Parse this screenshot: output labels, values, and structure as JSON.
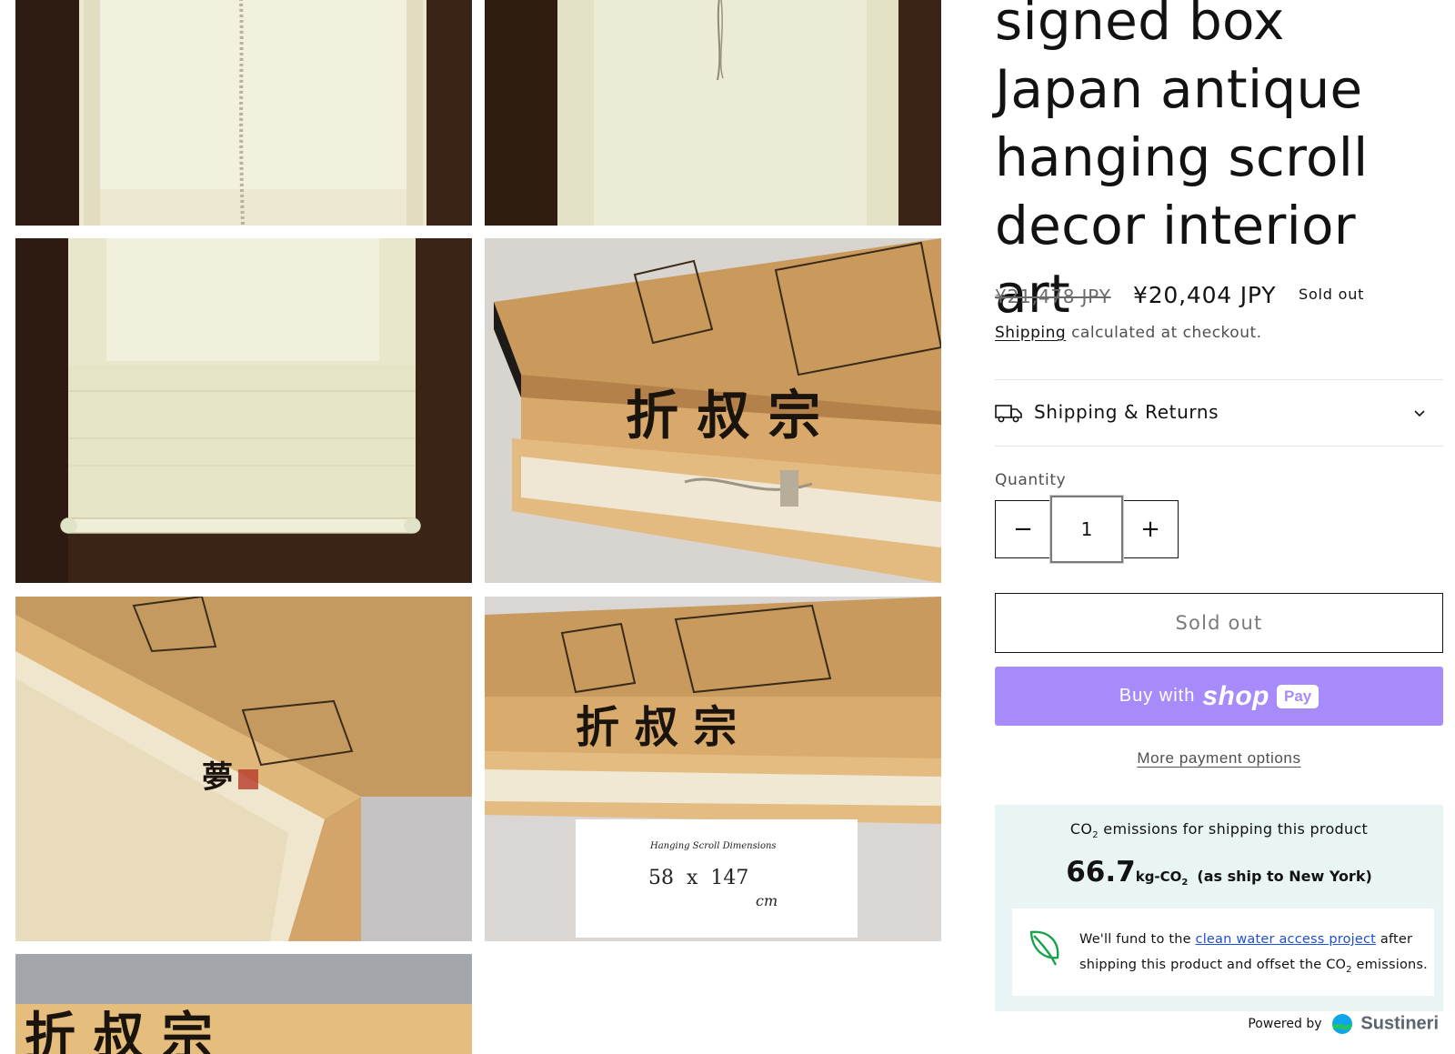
{
  "product": {
    "title": "signed box Japan antique hanging scroll decor interior art",
    "price_compare": "¥21,478 JPY",
    "price_sale": "¥20,404 JPY",
    "badge": "Sold out",
    "shipping_link": "Shipping",
    "shipping_note": "calculated at checkout."
  },
  "accordion": {
    "label": "Shipping & Returns",
    "icon": "truck-icon"
  },
  "quantity": {
    "label": "Quantity",
    "value": "1",
    "minus": "−",
    "plus": "+"
  },
  "buttons": {
    "sold_out": "Sold out",
    "buy_with": "Buy with",
    "shop_word": "shop",
    "pay_pill": "Pay",
    "more_payment": "More payment options"
  },
  "co2": {
    "title_pre": "CO",
    "title_sub": "2",
    "title_post": " emissions for shipping this product",
    "number": "66.7",
    "unit_pre": "kg-CO",
    "unit_sub": "2",
    "destination": "(as ship to New York)",
    "msg_pre": "We'll fund to the ",
    "msg_link": "clean water access project",
    "msg_mid": " after shipping this product and offset the CO",
    "msg_sub": "2",
    "msg_post": " emissions.",
    "powered_by": "Powered by",
    "brand": "Sustineri"
  },
  "gallery": {
    "note_title": "Hanging Scroll Dimensions",
    "note_dims": "58  x  147",
    "note_unit": "cm"
  },
  "colors": {
    "shop_pay": "#a78bfa",
    "co2_bg": "#e8f5f4",
    "link_blue": "#1d4ed8"
  }
}
